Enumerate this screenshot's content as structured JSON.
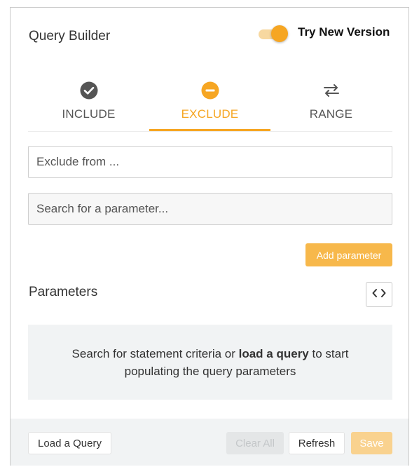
{
  "header": {
    "title": "Query Builder",
    "toggle_label": "Try New Version",
    "toggle_on": true
  },
  "tabs": [
    {
      "label": "INCLUDE",
      "icon": "check-circle-icon",
      "active": false
    },
    {
      "label": "EXCLUDE",
      "icon": "minus-circle-icon",
      "active": true
    },
    {
      "label": "RANGE",
      "icon": "swap-arrows-icon",
      "active": false
    }
  ],
  "form": {
    "exclude_placeholder": "Exclude from ...",
    "search_placeholder": "Search for a parameter...",
    "add_label": "Add parameter"
  },
  "parameters": {
    "title": "Parameters",
    "empty_pre": "Search for statement criteria or ",
    "empty_link": "load a query",
    "empty_post1": " to start",
    "empty_post2": "populating the query parameters"
  },
  "footer": {
    "load_label": "Load a Query",
    "clear_label": "Clear All",
    "refresh_label": "Refresh",
    "save_label": "Save"
  },
  "colors": {
    "accent": "#f6a623",
    "icon_gray": "#555555",
    "footer_bg": "#f1f3f4"
  }
}
